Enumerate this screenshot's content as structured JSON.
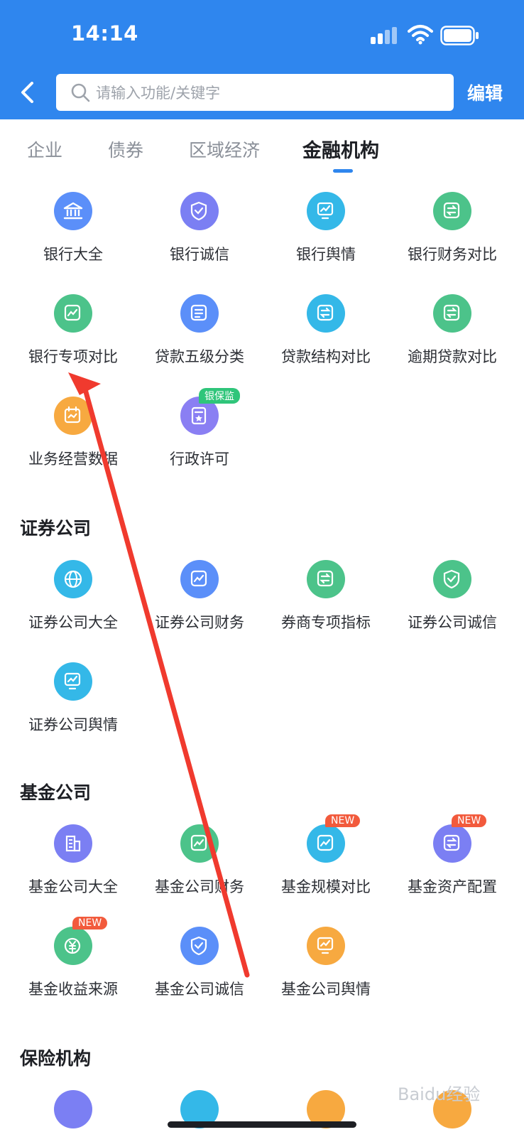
{
  "status_bar": {
    "time": "14:14"
  },
  "search": {
    "placeholder": "请输入功能/关键字"
  },
  "edit_label": "编辑",
  "tabs": [
    {
      "label": "企业"
    },
    {
      "label": "债券"
    },
    {
      "label": "区域经济"
    },
    {
      "label": "金融机构",
      "active": true
    }
  ],
  "bank_items": [
    {
      "label": "银行大全",
      "icon": "bank-icon",
      "color": "#5b8ff9"
    },
    {
      "label": "银行诚信",
      "icon": "shield-bank-icon",
      "color": "#7b7ff3"
    },
    {
      "label": "银行舆情",
      "icon": "monitor-bank-icon",
      "color": "#34b8e8"
    },
    {
      "label": "银行财务对比",
      "icon": "exchange-bank-icon",
      "color": "#4cc38a"
    },
    {
      "label": "银行专项对比",
      "icon": "chart-bank-icon",
      "color": "#4cc38a"
    },
    {
      "label": "贷款五级分类",
      "icon": "list-loan-icon",
      "color": "#5b8ff9"
    },
    {
      "label": "贷款结构对比",
      "icon": "exchange-loan-icon",
      "color": "#34b8e8"
    },
    {
      "label": "逾期贷款对比",
      "icon": "exchange-overdue-icon",
      "color": "#4cc38a"
    },
    {
      "label": "业务经营数据",
      "icon": "calendar-bank-icon",
      "color": "#f7a940"
    },
    {
      "label": "行政许可",
      "icon": "document-star-icon",
      "color": "#8a7ff3",
      "badge": "银保监"
    }
  ],
  "sections": {
    "securities": {
      "title": "证券公司"
    },
    "funds": {
      "title": "基金公司"
    },
    "insurance": {
      "title": "保险机构"
    }
  },
  "securities_items": [
    {
      "label": "证券公司大全",
      "icon": "globe-icon",
      "color": "#34b8e8"
    },
    {
      "label": "证券公司财务",
      "icon": "chart-securities-icon",
      "color": "#5b8ff9"
    },
    {
      "label": "券商专项指标",
      "icon": "exchange-securities-icon",
      "color": "#4cc38a"
    },
    {
      "label": "证券公司诚信",
      "icon": "shield-securities-icon",
      "color": "#4cc38a"
    },
    {
      "label": "证券公司舆情",
      "icon": "monitor-securities-icon",
      "color": "#34b8e8"
    }
  ],
  "fund_items": [
    {
      "label": "基金公司大全",
      "icon": "building-icon",
      "color": "#7b7ff3"
    },
    {
      "label": "基金公司财务",
      "icon": "chart-fund-icon",
      "color": "#4cc38a"
    },
    {
      "label": "基金规模对比",
      "icon": "chart-fund-scale-icon",
      "color": "#34b8e8",
      "badge": "NEW"
    },
    {
      "label": "基金资产配置",
      "icon": "exchange-fund-icon",
      "color": "#7b7ff3",
      "badge": "NEW"
    },
    {
      "label": "基金收益来源",
      "icon": "yuan-icon",
      "color": "#4cc38a",
      "badge": "NEW"
    },
    {
      "label": "基金公司诚信",
      "icon": "shield-fund-icon",
      "color": "#5b8ff9"
    },
    {
      "label": "基金公司舆情",
      "icon": "monitor-fund-icon",
      "color": "#f7a940"
    }
  ],
  "watermark": "Baidu经验"
}
